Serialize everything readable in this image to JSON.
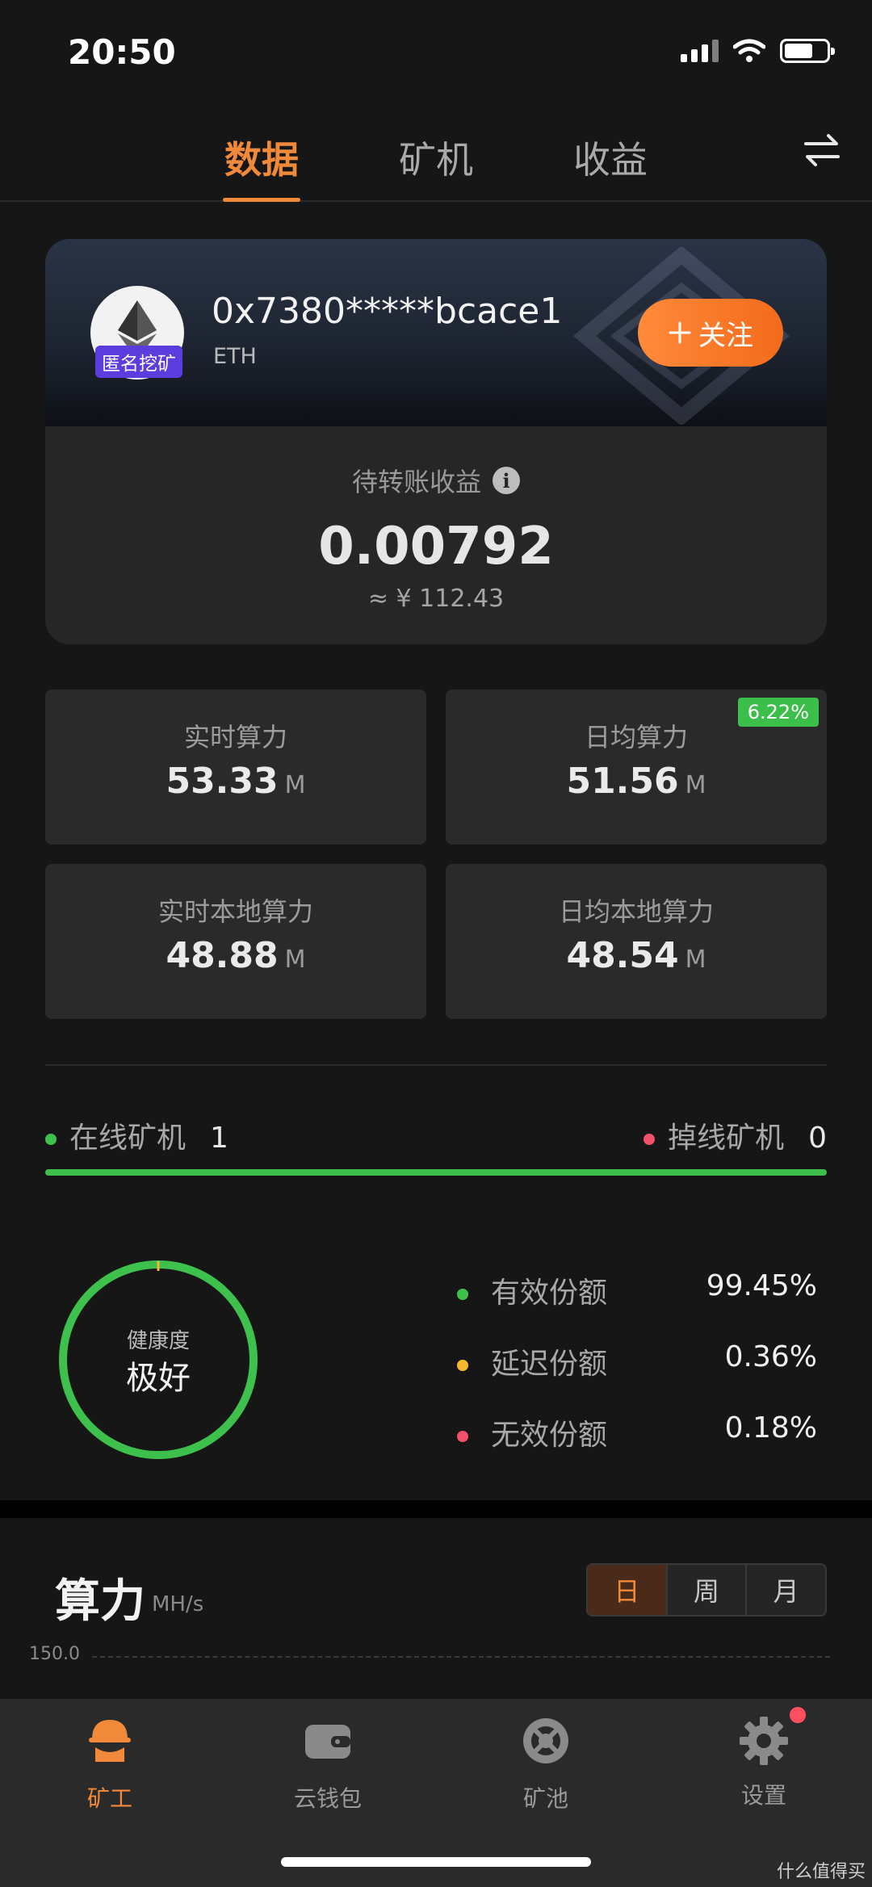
{
  "status_bar": {
    "time": "20:50"
  },
  "tabs": [
    {
      "label": "数据",
      "active": true
    },
    {
      "label": "矿机",
      "active": false
    },
    {
      "label": "收益",
      "active": false
    }
  ],
  "account": {
    "address": "0x7380*****bcace1",
    "coin": "ETH",
    "badge": "匿名挖矿",
    "follow_label": "关注",
    "pending_label": "待转账收益",
    "pending_value": "0.00792",
    "pending_cny": "≈ ¥ 112.43"
  },
  "stats": [
    {
      "label": "实时算力",
      "value": "53.33",
      "unit": "M"
    },
    {
      "label": "日均算力",
      "value": "51.56",
      "unit": "M",
      "badge": "6.22%"
    },
    {
      "label": "实时本地算力",
      "value": "48.88",
      "unit": "M"
    },
    {
      "label": "日均本地算力",
      "value": "48.54",
      "unit": "M"
    }
  ],
  "miners": {
    "online_label": "在线矿机",
    "online_count": "1",
    "offline_label": "掉线矿机",
    "offline_count": "0",
    "online_fraction": 1.0
  },
  "health": {
    "label": "健康度",
    "value": "极好",
    "shares": [
      {
        "name": "有效份额",
        "pct": "99.45%",
        "color": "#3ec14c"
      },
      {
        "name": "延迟份额",
        "pct": "0.36%",
        "color": "#f5b82e"
      },
      {
        "name": "无效份额",
        "pct": "0.18%",
        "color": "#f0506a"
      }
    ]
  },
  "hashrate": {
    "title": "算力",
    "unit": "MH/s",
    "ranges": [
      {
        "label": "日",
        "active": true
      },
      {
        "label": "周",
        "active": false
      },
      {
        "label": "月",
        "active": false
      }
    ],
    "y_ticks": [
      "150.0"
    ]
  },
  "bottom_nav": [
    {
      "label": "矿工",
      "icon": "miner-icon",
      "active": true
    },
    {
      "label": "云钱包",
      "icon": "wallet-icon",
      "active": false
    },
    {
      "label": "矿池",
      "icon": "pool-icon",
      "active": false
    },
    {
      "label": "设置",
      "icon": "gear-icon",
      "active": false,
      "notification": true
    }
  ],
  "watermark": "什么值得买",
  "colors": {
    "accent": "#f08a3a",
    "green": "#3ec14c",
    "yellow": "#f5b82e",
    "red": "#f0506a",
    "purple": "#5a3ddc"
  }
}
